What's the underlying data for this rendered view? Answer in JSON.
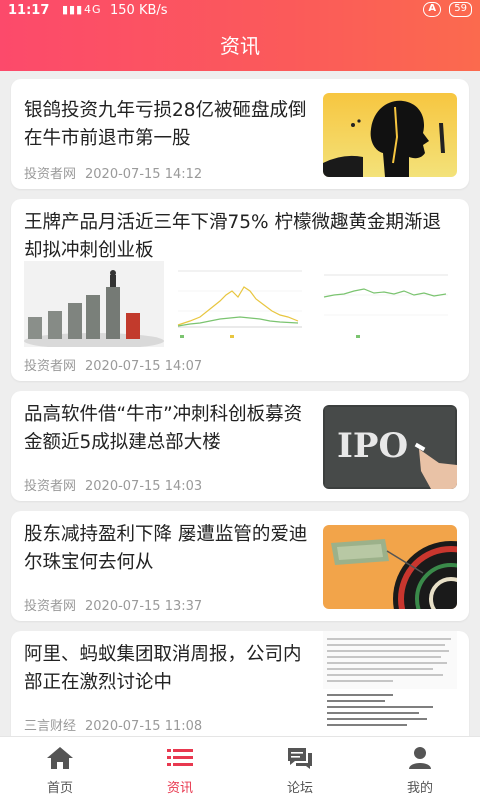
{
  "status_bar": {
    "time": "11:17",
    "network": "4G",
    "speed": "150 KB/s",
    "battery": "59",
    "vpn_badge": "A"
  },
  "header": {
    "title": "资讯"
  },
  "articles": [
    {
      "title": "银鸽投资九年亏损28亿被砸盘成倒在牛市前退市第一股",
      "source": "投资者网",
      "date": "2020-07-15 14:12",
      "thumb": "silhouette-head-image"
    },
    {
      "title": "王牌产品月活近三年下滑75%  柠檬微趣黄金期渐退却拟冲刺创业板",
      "source": "投资者网",
      "date": "2020-07-15 14:07",
      "thumbs": [
        "bar-blocks-image",
        "line-chart-image",
        "line-chart-image"
      ]
    },
    {
      "title": "品高软件借“牛市”冲刺科创板募资金额近5成拟建总部大楼",
      "source": "投资者网",
      "date": "2020-07-15 14:03",
      "thumb": "ipo-chalkboard-image"
    },
    {
      "title": "股东减持盈利下降  屡遭监管的爱迪尔珠宝何去何从",
      "source": "投资者网",
      "date": "2020-07-15 13:37",
      "thumb": "dart-money-image"
    },
    {
      "title": "阿里、蚂蚁集团取消周报，公司内部正在激烈讨论中",
      "source": "三言财经",
      "date": "2020-07-15 11:08",
      "thumb": "screenshot-text-image"
    }
  ],
  "tabs": [
    {
      "label": "首页",
      "icon": "home-icon",
      "active": false
    },
    {
      "label": "资讯",
      "icon": "news-list-icon",
      "active": true
    },
    {
      "label": "论坛",
      "icon": "forum-icon",
      "active": false
    },
    {
      "label": "我的",
      "icon": "profile-icon",
      "active": false
    }
  ],
  "colors": {
    "header_start": "#fc4a6b",
    "header_end": "#fb6a4e",
    "accent": "#e8384f"
  }
}
